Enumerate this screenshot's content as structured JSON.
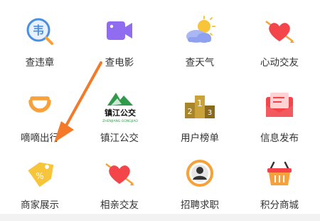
{
  "grid": {
    "items": [
      {
        "label": "查违章",
        "icon": "violation-icon"
      },
      {
        "label": "查电影",
        "icon": "movie-camera-icon"
      },
      {
        "label": "查天气",
        "icon": "weather-icon"
      },
      {
        "label": "心动交友",
        "icon": "heart-arrow-icon"
      },
      {
        "label": "嘀嘀出行",
        "icon": "didi-icon"
      },
      {
        "label": "镇江公交",
        "icon": "zhenjiang-bus-logo"
      },
      {
        "label": "用户榜单",
        "icon": "podium-icon"
      },
      {
        "label": "信息发布",
        "icon": "envelope-icon"
      },
      {
        "label": "商家展示",
        "icon": "price-tag-icon"
      },
      {
        "label": "相亲交友",
        "icon": "heart-arrow-icon"
      },
      {
        "label": "招聘求职",
        "icon": "person-badge-icon"
      },
      {
        "label": "积分商城",
        "icon": "shopping-basket-icon"
      }
    ],
    "logo_text": {
      "main": "镇江公交",
      "sub": "ZHENJIANG GONGJIAO"
    }
  },
  "colors": {
    "accent_blue": "#4a90e2",
    "accent_purple": "#8f6cf0",
    "accent_orange": "#f7a13a",
    "accent_red": "#f4454b",
    "accent_green": "#2e9a4a",
    "arrow": "#f47a2a"
  }
}
